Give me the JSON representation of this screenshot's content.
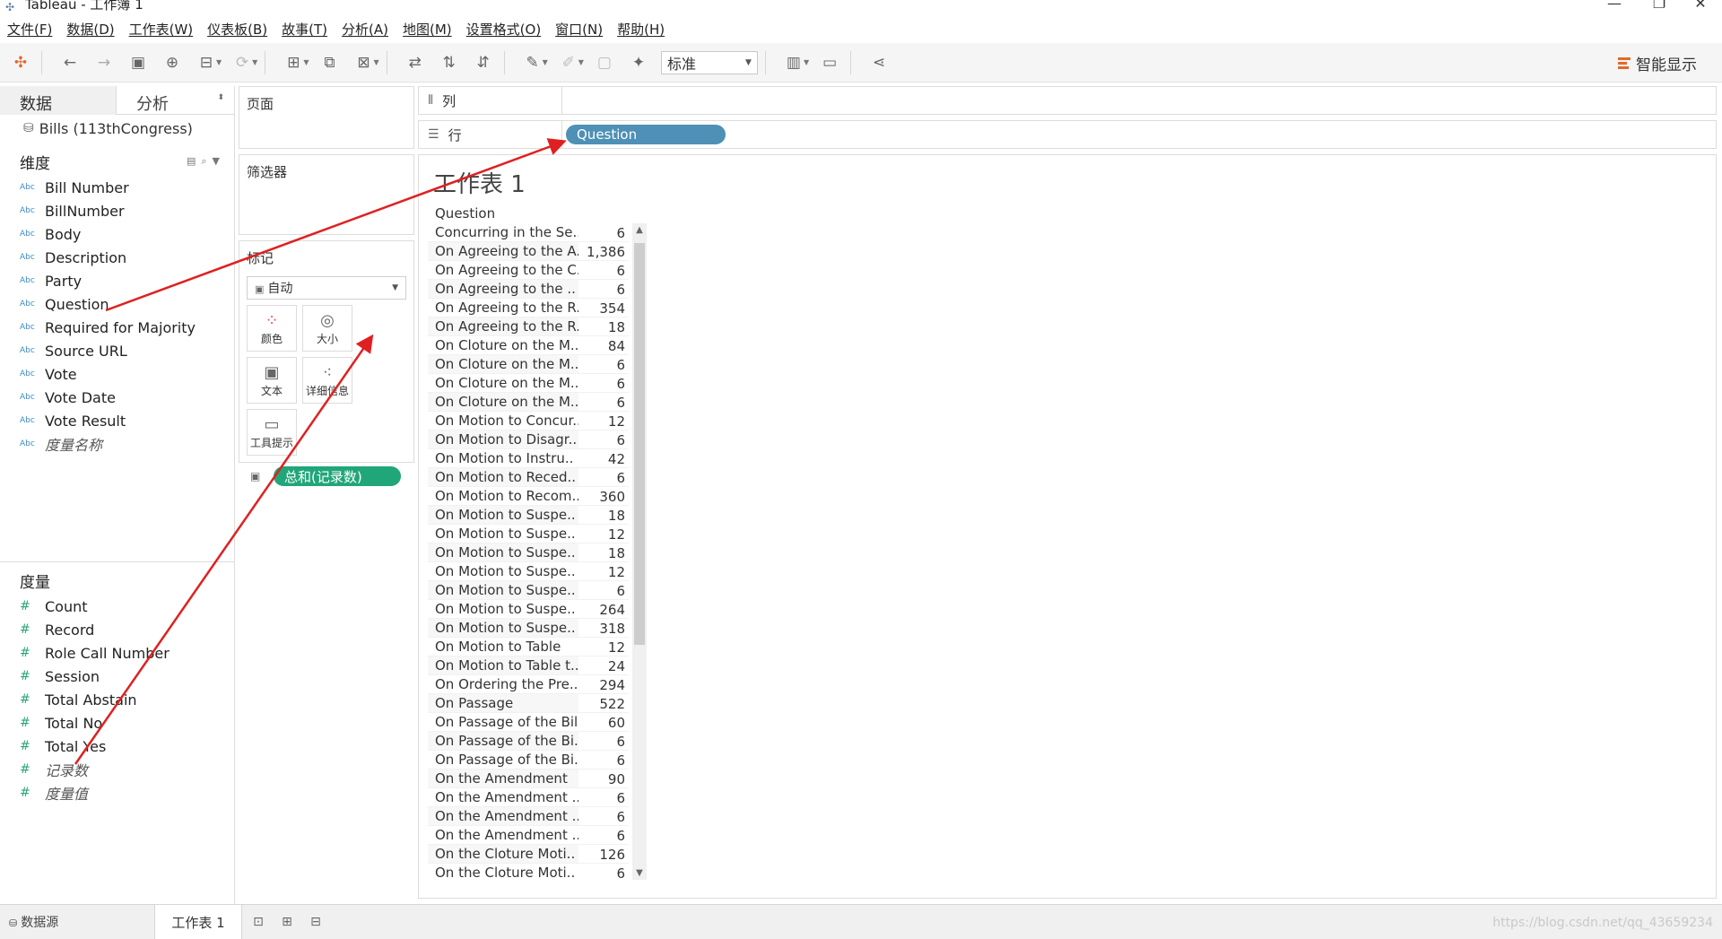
{
  "window": {
    "title": "Tableau - 工作簿 1",
    "min": "—",
    "max": "❐",
    "close": "✕"
  },
  "menu": [
    "文件(F)",
    "数据(D)",
    "工作表(W)",
    "仪表板(B)",
    "故事(T)",
    "分析(A)",
    "地图(M)",
    "设置格式(O)",
    "窗口(N)",
    "帮助(H)"
  ],
  "toolbar": {
    "fit_value": "标准",
    "show_me": "智能显示"
  },
  "left_pane": {
    "tab_data": "数据",
    "tab_analysis": "分析",
    "datasource": "Bills (113thCongress)",
    "dimensions_title": "维度",
    "dimensions": [
      "Bill Number",
      "BillNumber",
      "Body",
      "Description",
      "Party",
      "Question",
      "Required for Majority",
      "Source URL",
      "Vote",
      "Vote Date",
      "Vote Result",
      "度量名称"
    ],
    "dimension_type": "Abc",
    "measures_title": "度量",
    "measures": [
      "Count",
      "Record",
      "Role Call Number",
      "Session",
      "Total Abstain",
      "Total No",
      "Total Yes",
      "记录数",
      "度量值"
    ],
    "measure_type": "#"
  },
  "shelves": {
    "pages": "页面",
    "filters": "筛选器",
    "marks": "标记",
    "marks_type": "自动",
    "mark_buttons": [
      "颜色",
      "大小",
      "文本",
      "详细信息",
      "工具提示"
    ],
    "mark_pill": "总和(记录数)",
    "columns_label": "列",
    "rows_label": "行",
    "rows_pill": "Question"
  },
  "viz": {
    "title": "工作表 1",
    "column_header": "Question",
    "rows": [
      {
        "q": "Concurring in the Se..",
        "v": "6"
      },
      {
        "q": "On Agreeing to the A..",
        "v": "1,386"
      },
      {
        "q": "On Agreeing to the C..",
        "v": "6"
      },
      {
        "q": "On Agreeing to the ..",
        "v": "6"
      },
      {
        "q": "On Agreeing to the R..",
        "v": "354"
      },
      {
        "q": "On Agreeing to the R..",
        "v": "18"
      },
      {
        "q": "On Cloture on the M..",
        "v": "84"
      },
      {
        "q": "On Cloture on the M..",
        "v": "6"
      },
      {
        "q": "On Cloture on the M..",
        "v": "6"
      },
      {
        "q": "On Cloture on the M..",
        "v": "6"
      },
      {
        "q": "On Motion to Concur..",
        "v": "12"
      },
      {
        "q": "On Motion to Disagr..",
        "v": "6"
      },
      {
        "q": "On Motion to Instru..",
        "v": "42"
      },
      {
        "q": "On Motion to Reced..",
        "v": "6"
      },
      {
        "q": "On Motion to Recom..",
        "v": "360"
      },
      {
        "q": "On Motion to Suspe..",
        "v": "18"
      },
      {
        "q": "On Motion to Suspe..",
        "v": "12"
      },
      {
        "q": "On Motion to Suspe..",
        "v": "18"
      },
      {
        "q": "On Motion to Suspe..",
        "v": "12"
      },
      {
        "q": "On Motion to Suspe..",
        "v": "6"
      },
      {
        "q": "On Motion to Suspe..",
        "v": "264"
      },
      {
        "q": "On Motion to Suspe..",
        "v": "318"
      },
      {
        "q": "On Motion to Table",
        "v": "12"
      },
      {
        "q": "On Motion to Table t..",
        "v": "24"
      },
      {
        "q": "On Ordering the Pre..",
        "v": "294"
      },
      {
        "q": "On Passage",
        "v": "522"
      },
      {
        "q": "On Passage of the Bill",
        "v": "60"
      },
      {
        "q": "On Passage of the Bi..",
        "v": "6"
      },
      {
        "q": "On Passage of the Bi..",
        "v": "6"
      },
      {
        "q": "On the Amendment",
        "v": "90"
      },
      {
        "q": "On the Amendment ..",
        "v": "6"
      },
      {
        "q": "On the Amendment ..",
        "v": "6"
      },
      {
        "q": "On the Amendment ..",
        "v": "6"
      },
      {
        "q": "On the Cloture Moti..",
        "v": "126"
      },
      {
        "q": "On the Cloture Moti..",
        "v": "6"
      }
    ]
  },
  "bottom": {
    "datasource_tab": "数据源",
    "sheet_tab": "工作表 1",
    "watermark": "https://blog.csdn.net/qq_43659234"
  },
  "colors": {
    "pill_blue": "#4e90b6",
    "pill_green": "#21a67a",
    "annotation_red": "#e02020"
  }
}
